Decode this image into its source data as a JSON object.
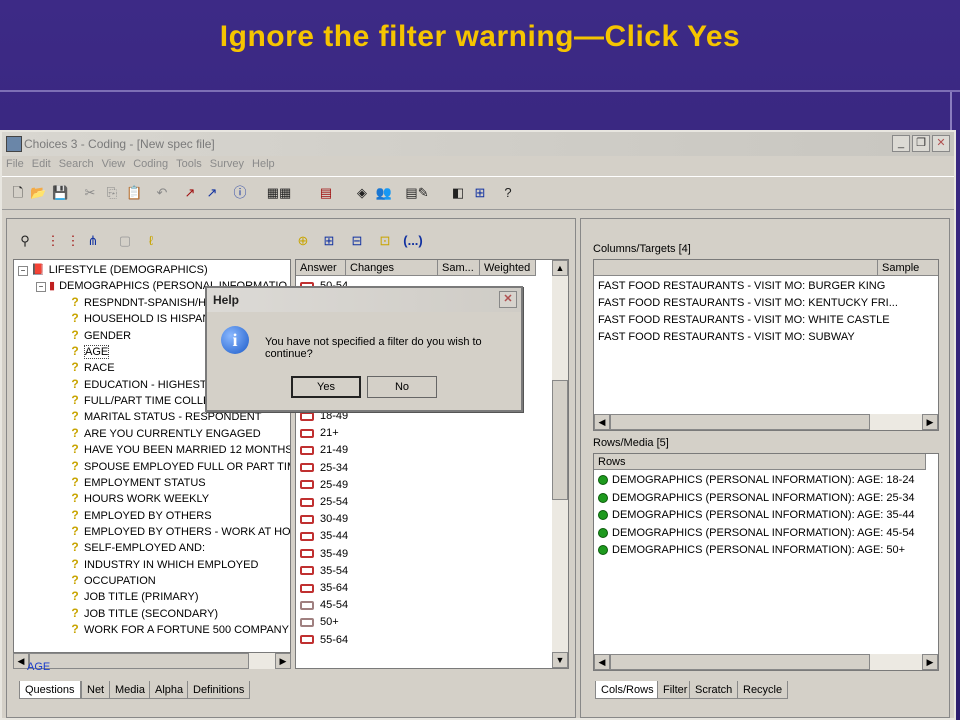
{
  "slide_title": "Ignore the filter warning—Click Yes",
  "window": {
    "title": "Choices 3 - Coding - [New spec file]"
  },
  "menu": [
    "File",
    "Edit",
    "Search",
    "View",
    "Coding",
    "Tools",
    "Survey",
    "Help"
  ],
  "tree": {
    "root": "LIFESTYLE (DEMOGRAPHICS)",
    "group": "DEMOGRAPHICS (PERSONAL INFORMATIO",
    "items": [
      "RESPNDNT-SPANISH/HIS",
      "HOUSEHOLD IS HISPANIC",
      "GENDER",
      "AGE",
      "RACE",
      "EDUCATION - HIGHEST L",
      "FULL/PART TIME COLLEC",
      "MARITAL STATUS - RESPONDENT",
      "ARE YOU CURRENTLY ENGAGED",
      "HAVE YOU BEEN MARRIED 12 MONTHS",
      "SPOUSE EMPLOYED FULL OR PART TIM",
      "EMPLOYMENT STATUS",
      "HOURS WORK WEEKLY",
      "EMPLOYED BY OTHERS",
      "EMPLOYED BY OTHERS - WORK AT HO",
      "SELF-EMPLOYED AND:",
      "INDUSTRY IN WHICH EMPLOYED",
      "OCCUPATION",
      "JOB TITLE (PRIMARY)",
      "JOB TITLE (SECONDARY)",
      "WORK FOR A FORTUNE 500 COMPANY"
    ]
  },
  "answers": {
    "headers": [
      "Answer",
      "Changes",
      "Sam...",
      "Weighted"
    ],
    "top": "50-54",
    "rows": [
      "18-49",
      "21+",
      "21-49",
      "25-34",
      "25-49",
      "25-54",
      "30-49",
      "35-44",
      "35-49",
      "35-54",
      "35-64",
      "45-54",
      "50+",
      "55-64"
    ]
  },
  "left_status": "AGE",
  "left_tabs": [
    "Questions",
    "Net",
    "Media",
    "Alpha",
    "Definitions"
  ],
  "columns": {
    "label": "Columns/Targets [4]",
    "header_sample": "Sample",
    "rows": [
      "FAST FOOD RESTAURANTS - VISIT MO: BURGER KING",
      "FAST FOOD RESTAURANTS - VISIT MO: KENTUCKY FRI...",
      "FAST FOOD RESTAURANTS - VISIT MO: WHITE CASTLE",
      "FAST FOOD RESTAURANTS - VISIT MO: SUBWAY"
    ]
  },
  "rows_media": {
    "label": "Rows/Media [5]",
    "header": "Rows",
    "rows": [
      "DEMOGRAPHICS (PERSONAL INFORMATION): AGE: 18-24",
      "DEMOGRAPHICS (PERSONAL INFORMATION): AGE: 25-34",
      "DEMOGRAPHICS (PERSONAL INFORMATION): AGE: 35-44",
      "DEMOGRAPHICS (PERSONAL INFORMATION): AGE: 45-54",
      "DEMOGRAPHICS (PERSONAL INFORMATION): AGE: 50+"
    ]
  },
  "right_tabs": [
    "Cols/Rows",
    "Filter",
    "Scratch",
    "Recycle"
  ],
  "dialog": {
    "title": "Help",
    "message": "You have not specified a filter do you wish to continue?",
    "yes": "Yes",
    "no": "No"
  },
  "colors": {
    "title": "#f5c400",
    "background": "#2c1e6e",
    "status": "#1a3ccc"
  }
}
